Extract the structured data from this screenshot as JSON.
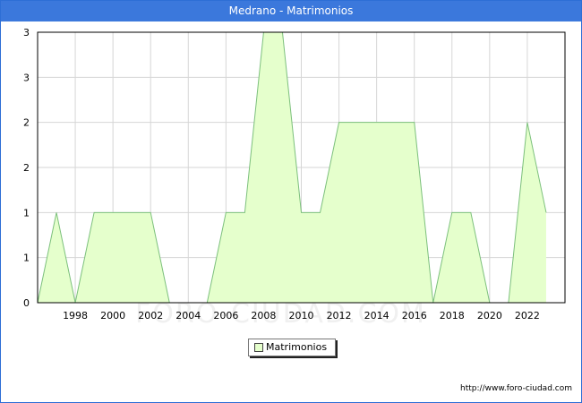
{
  "window": {
    "title": "Medrano - Matrimonios"
  },
  "watermark": "FORO-CIUDAD.COM",
  "source": "http://www.foro-ciudad.com",
  "colors": {
    "fill": "#e5ffcc",
    "line": "#7cc07c",
    "title_bar": "#3b78dc",
    "grid": "#d6d6d6"
  },
  "chart_data": {
    "type": "area",
    "title": "Medrano - Matrimonios",
    "x": [
      1996,
      1997,
      1998,
      1999,
      2000,
      2001,
      2002,
      2003,
      2004,
      2005,
      2006,
      2007,
      2008,
      2009,
      2010,
      2011,
      2012,
      2013,
      2014,
      2015,
      2016,
      2017,
      2018,
      2019,
      2020,
      2021,
      2022,
      2023
    ],
    "series": [
      {
        "name": "Matrimonios",
        "values": [
          0,
          1,
          0,
          1,
          1,
          1,
          1,
          0,
          0,
          0,
          1,
          1,
          3,
          3,
          1,
          1,
          2,
          2,
          2,
          2,
          2,
          0,
          1,
          1,
          0,
          0,
          2,
          1
        ]
      }
    ],
    "xlim": [
      1996,
      2024
    ],
    "ylim": [
      0,
      3
    ],
    "x_ticks": [
      "1998",
      "2000",
      "2002",
      "2004",
      "2006",
      "2008",
      "2010",
      "2012",
      "2014",
      "2016",
      "2018",
      "2020",
      "2022"
    ],
    "y_ticks": [
      "0",
      "1",
      "1",
      "2",
      "2",
      "3",
      "3"
    ],
    "grid": true,
    "legend": "bottom-center"
  }
}
